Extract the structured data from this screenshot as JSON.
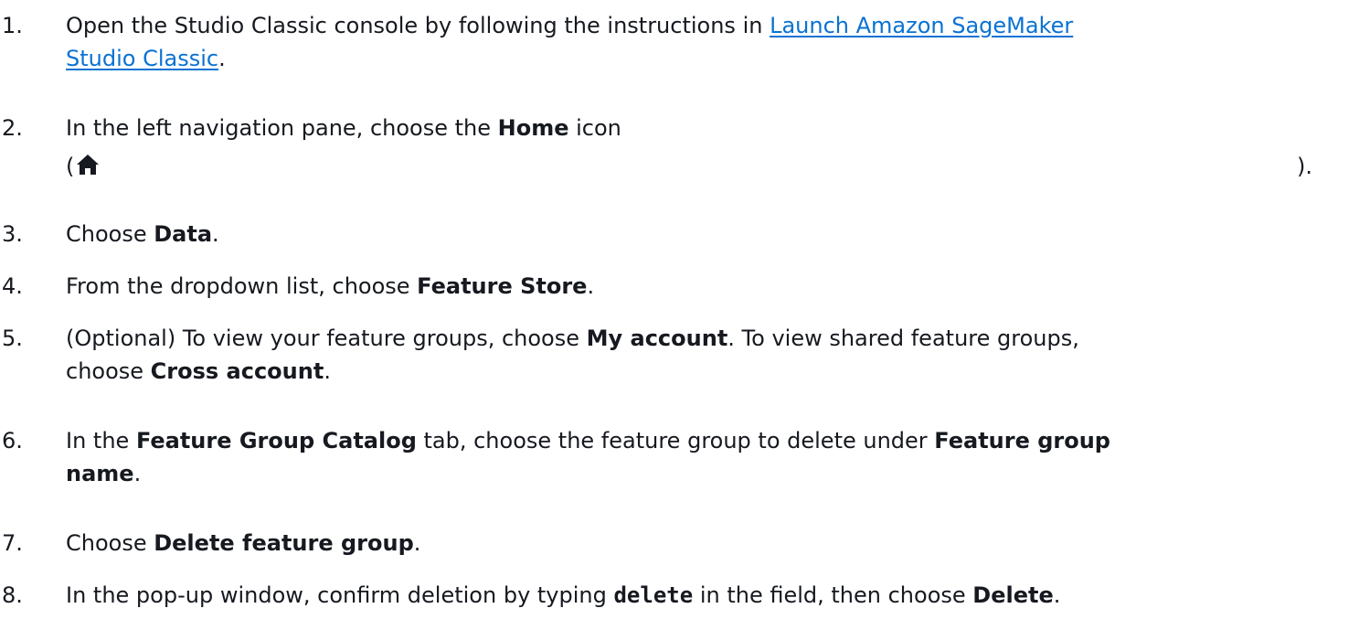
{
  "steps": [
    {
      "number": "1.",
      "before": "Open the Studio Classic console by following the instructions in ",
      "link_line1": "Launch Amazon SageMaker",
      "link_line2": "Studio Classic",
      "after": "."
    },
    {
      "number": "2.",
      "before": "In the left navigation pane, choose the ",
      "bold": "Home",
      "after": " icon",
      "paren_open": "(",
      "icon": "home-icon",
      "paren_close": ")."
    },
    {
      "number": "3.",
      "before": "Choose ",
      "bold": "Data",
      "after": "."
    },
    {
      "number": "4.",
      "before": "From the dropdown list, choose ",
      "bold": "Feature Store",
      "after": "."
    },
    {
      "number": "5.",
      "before": "(Optional) To view your feature groups, choose ",
      "bold1": "My account",
      "middle": ". To view shared feature groups,",
      "line2_before": "choose ",
      "bold2": "Cross account",
      "after": "."
    },
    {
      "number": "6.",
      "before": "In the ",
      "bold1": "Feature Group Catalog",
      "middle": " tab, choose the feature group to delete under ",
      "bold2a": "Feature group",
      "bold2b": "name",
      "after": "."
    },
    {
      "number": "7.",
      "before": "Choose ",
      "bold": "Delete feature group",
      "after": "."
    },
    {
      "number": "8.",
      "before": "In the pop-up window, confirm deletion by typing ",
      "code": "delete",
      "middle": " in the field, then choose ",
      "bold": "Delete",
      "after": "."
    }
  ],
  "colors": {
    "text": "#16191f",
    "link": "#0972d3"
  }
}
